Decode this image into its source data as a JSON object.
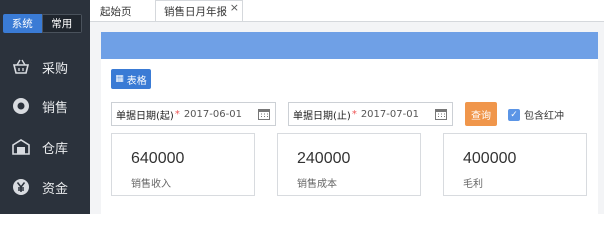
{
  "sidebar": {
    "segments": [
      "系统",
      "常用"
    ],
    "items": [
      {
        "label": "采购",
        "icon": "basket-icon"
      },
      {
        "label": "销售",
        "icon": "coin-icon"
      },
      {
        "label": "仓库",
        "icon": "warehouse-icon"
      },
      {
        "label": "资金",
        "icon": "yen-icon"
      }
    ]
  },
  "tabs": {
    "home": "起始页",
    "report": "销售日月年报",
    "close": "×"
  },
  "toolbar": {
    "table_label": "表格"
  },
  "filters": {
    "start_label": "单据日期(起)",
    "start_value": "2017-06-01",
    "end_label": "单据日期(止)",
    "end_value": "2017-07-01",
    "required_mark": "*",
    "query_label": "查询",
    "include_red_label": "包含红冲",
    "include_red_checked": true
  },
  "cards": [
    {
      "value": "640000",
      "caption": "销售收入"
    },
    {
      "value": "240000",
      "caption": "销售成本"
    },
    {
      "value": "400000",
      "caption": "毛利"
    }
  ],
  "colors": {
    "sidebar_bg": "#2b323c",
    "accent": "#3a7bd5",
    "banner": "#6fa0e6",
    "query_button": "#f0964b"
  }
}
